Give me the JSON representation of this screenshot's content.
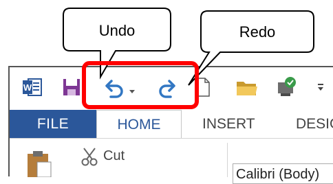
{
  "callouts": {
    "undo_text": "Undo",
    "redo_text": "Redo"
  },
  "tabs": {
    "file": "FILE",
    "home": "HOME",
    "insert": "INSERT",
    "design": "DESIG"
  },
  "ribbon": {
    "cut_label": "Cut",
    "font_name": "Calibri (Body)"
  },
  "colors": {
    "word_blue": "#2b579a",
    "highlight_red": "#ff0000",
    "undo_blue": "#3277c3",
    "save_purple": "#7e3794",
    "folder_yellow": "#e8b84a"
  },
  "icons": [
    "word-app-icon",
    "save-icon",
    "undo-icon",
    "undo-dropdown-icon",
    "redo-icon",
    "new-document-icon",
    "open-folder-icon",
    "spellcheck-icon",
    "customize-qat-icon",
    "paste-icon",
    "cut-icon"
  ]
}
